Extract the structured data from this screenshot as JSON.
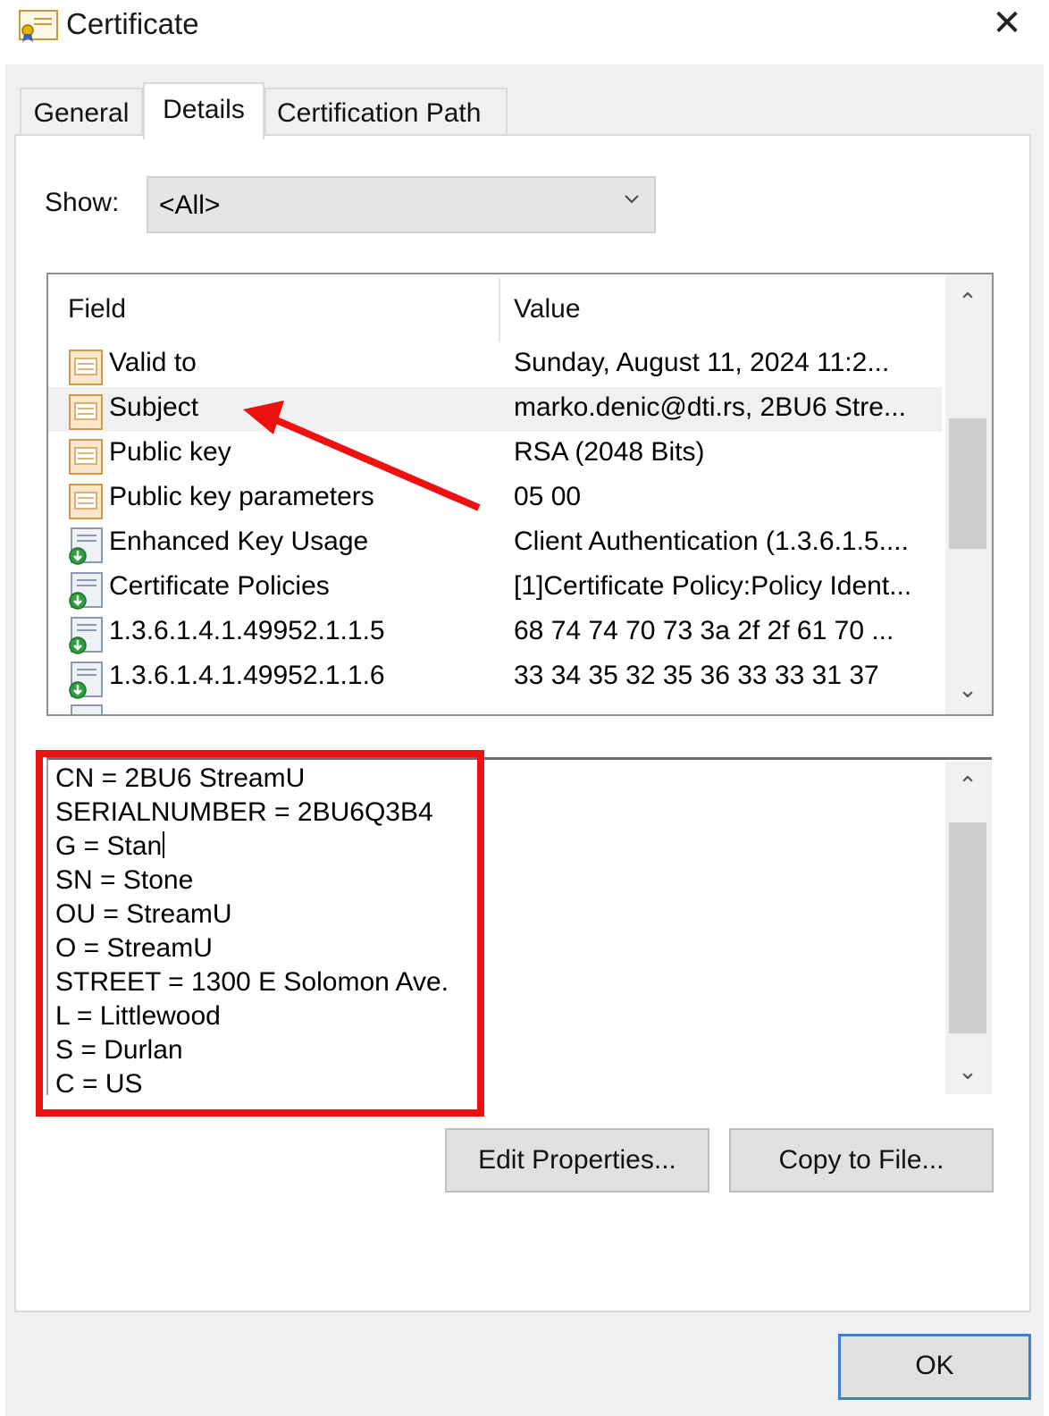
{
  "window": {
    "title": "Certificate",
    "close_glyph": "✕",
    "icon": "certificate-icon"
  },
  "tabs": [
    {
      "label": "General",
      "selected": false
    },
    {
      "label": "Details",
      "selected": true
    },
    {
      "label": "Certification Path",
      "selected": false
    }
  ],
  "show": {
    "label": "Show:",
    "selected": "<All>"
  },
  "fields_table": {
    "columns": [
      "Field",
      "Value"
    ],
    "rows": [
      {
        "field": "Valid to",
        "value": "Sunday, August 11, 2024 11:2...",
        "icon": "document-icon",
        "selected": false
      },
      {
        "field": "Subject",
        "value": "marko.denic@dti.rs, 2BU6 Stre...",
        "icon": "document-icon",
        "selected": true
      },
      {
        "field": "Public key",
        "value": "RSA (2048 Bits)",
        "icon": "document-icon",
        "selected": false
      },
      {
        "field": "Public key parameters",
        "value": "05 00",
        "icon": "document-icon",
        "selected": false
      },
      {
        "field": "Enhanced Key Usage",
        "value": "Client Authentication (1.3.6.1.5....",
        "icon": "extension-icon",
        "selected": false
      },
      {
        "field": "Certificate Policies",
        "value": "[1]Certificate Policy:Policy Ident...",
        "icon": "extension-icon",
        "selected": false
      },
      {
        "field": "1.3.6.1.4.1.49952.1.1.5",
        "value": "68 74 74 70 73 3a 2f 2f 61 70 ...",
        "icon": "extension-icon",
        "selected": false
      },
      {
        "field": "1.3.6.1.4.1.49952.1.1.6",
        "value": "33 34 35 32 35 36 33 33 31 37",
        "icon": "extension-icon",
        "selected": false
      }
    ],
    "scroll_position": 0.45
  },
  "value_text": {
    "lines": [
      "CN = 2BU6 StreamU",
      "SERIALNUMBER = 2BU6Q3B4",
      "G = Stan",
      "SN = Stone",
      "OU = StreamU",
      "O = StreamU",
      "STREET = 1300 E Solomon Ave.",
      "L = Littlewood",
      "S = Durlan",
      "C = US"
    ],
    "scroll_position": 0.55
  },
  "buttons": {
    "edit_properties": "Edit Properties...",
    "copy_to_file": "Copy to File...",
    "ok": "OK"
  },
  "colors": {
    "annotation_red": "#ee1111",
    "ok_border": "#3c7fd4",
    "dialog_bg": "#f0f0f0"
  }
}
